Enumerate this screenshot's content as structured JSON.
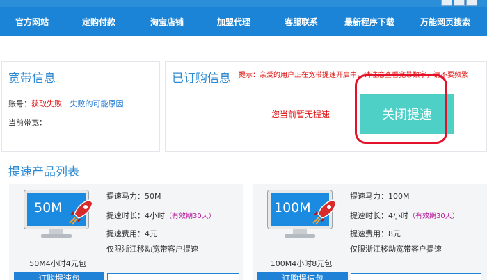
{
  "nav": {
    "items": [
      "官方网站",
      "定购付款",
      "淘宝店铺",
      "加盟代理",
      "客服联系",
      "最新程序下载",
      "万能网页搜索"
    ]
  },
  "broadband": {
    "title": "宽带信息",
    "account_label": "账号：",
    "account_value": "获取失败",
    "reason_link": "失败的可能原因",
    "bandwidth_label": "当前带宽："
  },
  "subscription": {
    "title": "已订购信息",
    "hint": "提示：亲爱的用户正在宽带提速开启中，请注意查看宽带数字，请不要频繁",
    "notice": "您当前暂无提速",
    "close_button": "关闭提速"
  },
  "products": {
    "title": "提速产品列表",
    "items": [
      {
        "screen_label": "50M",
        "power": "提速马力：50M",
        "duration": "提速时长：4小时",
        "validity": "（有效期30天）",
        "fee": "提速费用：4元",
        "restriction": "仅限浙江移动宽带客户提速",
        "caption": "50M4小时4元包",
        "buy_label": "订购提速包"
      },
      {
        "screen_label": "100M",
        "power": "提速马力：100M",
        "duration": "提速时长：4小时",
        "validity": "（有效期30天）",
        "fee": "提速费用：8元",
        "restriction": "仅限浙江移动宽带客户提速",
        "caption": "100M4小时8元包",
        "buy_label": "订购提速包"
      }
    ]
  },
  "colors": {
    "nav_bg": "#1b84d6",
    "title_blue": "#2f8bd3",
    "alert_red": "#e01010",
    "close_button": "#4fd0c7",
    "highlight_circle": "#e4112a"
  }
}
